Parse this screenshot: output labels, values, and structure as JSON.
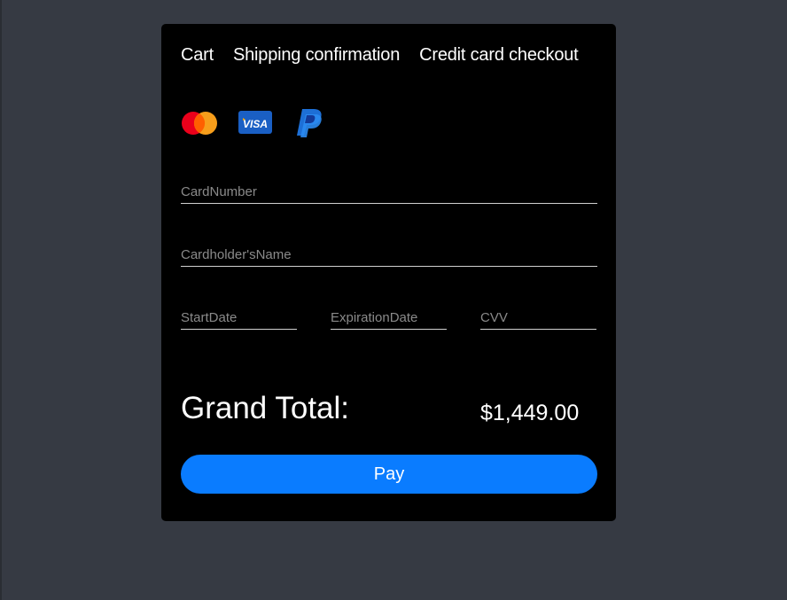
{
  "tabs": [
    {
      "label": "Cart"
    },
    {
      "label": "Shipping confirmation"
    },
    {
      "label": "Credit card checkout"
    }
  ],
  "payment_methods": [
    {
      "name": "mastercard-icon",
      "label": "Mastercard"
    },
    {
      "name": "visa-icon",
      "label": "VISA"
    },
    {
      "name": "paypal-icon",
      "label": "PayPal"
    }
  ],
  "form": {
    "card_number": {
      "value": "",
      "placeholder": "CardNumber"
    },
    "cardholder_name": {
      "value": "",
      "placeholder": "Cardholder'sName"
    },
    "start_date": {
      "value": "",
      "placeholder": "StartDate"
    },
    "expiration_date": {
      "value": "",
      "placeholder": "ExpirationDate"
    },
    "cvv": {
      "value": "",
      "placeholder": "CVV"
    }
  },
  "summary": {
    "total_label": "Grand Total:",
    "total_value": "$1,449.00"
  },
  "actions": {
    "pay_label": "Pay"
  },
  "colors": {
    "page_bg": "#363a43",
    "card_bg": "#000000",
    "accent": "#0a7cff"
  }
}
